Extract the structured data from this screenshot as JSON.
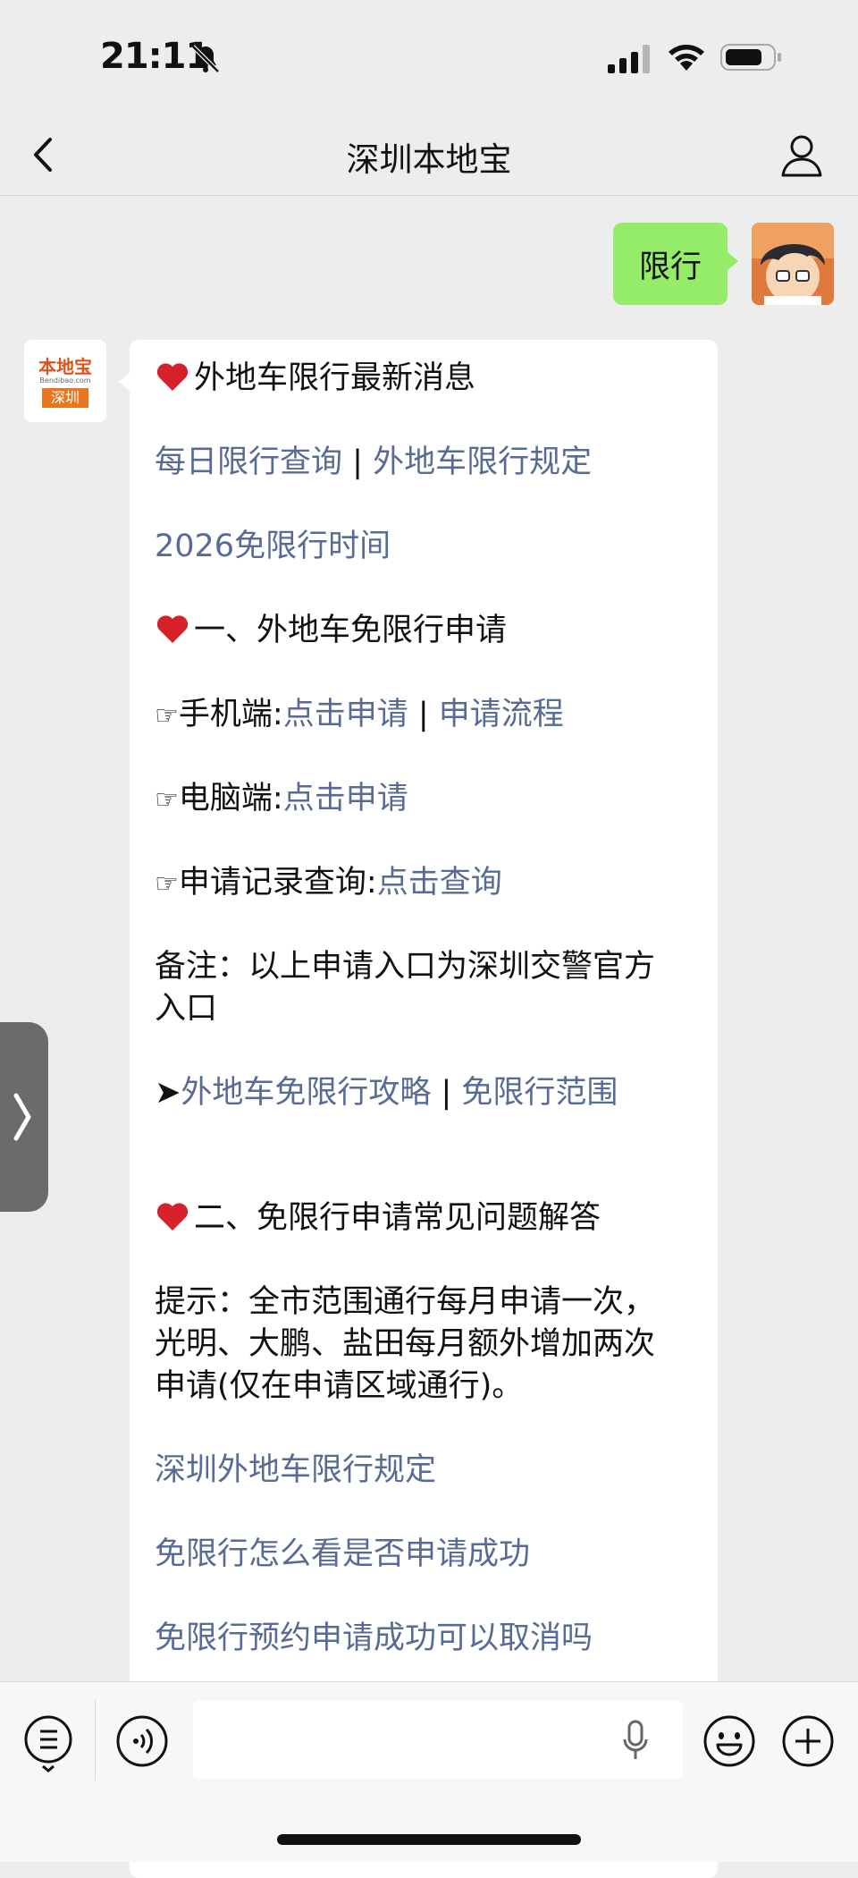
{
  "status_bar": {
    "time": "21:11"
  },
  "nav": {
    "title": "深圳本地宝"
  },
  "user_message": {
    "text": "限行"
  },
  "bot_avatar": {
    "line1": "本地宝",
    "line2": "Bendibao.com",
    "line3": "深圳"
  },
  "message": {
    "heading1": "外地车限行最新消息",
    "link_daily": "每日限行查询",
    "sep": "|",
    "link_rules": "外地车限行规定",
    "link_2026": "2026免限行时间",
    "heading2": "一、外地车免限行申请",
    "finger": "☞",
    "mobile_label": "手机端:",
    "mobile_apply": "点击申请",
    "mobile_process": "申请流程",
    "pc_label": "电脑端:",
    "pc_apply": "点击申请",
    "record_label": "申请记录查询:",
    "record_query": "点击查询",
    "note_line1": "备注：以上申请入口为深圳交警官方",
    "note_line2": "入口",
    "arrow": "➤",
    "link_guide": "外地车免限行攻略",
    "link_scope": "免限行范围",
    "heading3": "二、免限行申请常见问题解答",
    "tip_line1": "提示：全市范围通行每月申请一次，",
    "tip_line2": "光明、大鹏、盐田每月额外增加两次",
    "tip_line3": "申请(仅在申请区域通行)。",
    "faq1": "深圳外地车限行规定",
    "faq2": "免限行怎么看是否申请成功",
    "faq3": "免限行预约申请成功可以取消吗"
  },
  "colors": {
    "link": "#576b95",
    "user_bubble": "#95ec69",
    "background": "#ededed"
  },
  "icons": [
    "bell-slash-icon",
    "signal-icon",
    "wifi-icon",
    "battery-icon",
    "back-icon",
    "person-icon",
    "heart-icon",
    "chevron-right-icon",
    "menu-icon",
    "voice-icon",
    "mic-icon",
    "emoji-icon",
    "plus-icon"
  ]
}
